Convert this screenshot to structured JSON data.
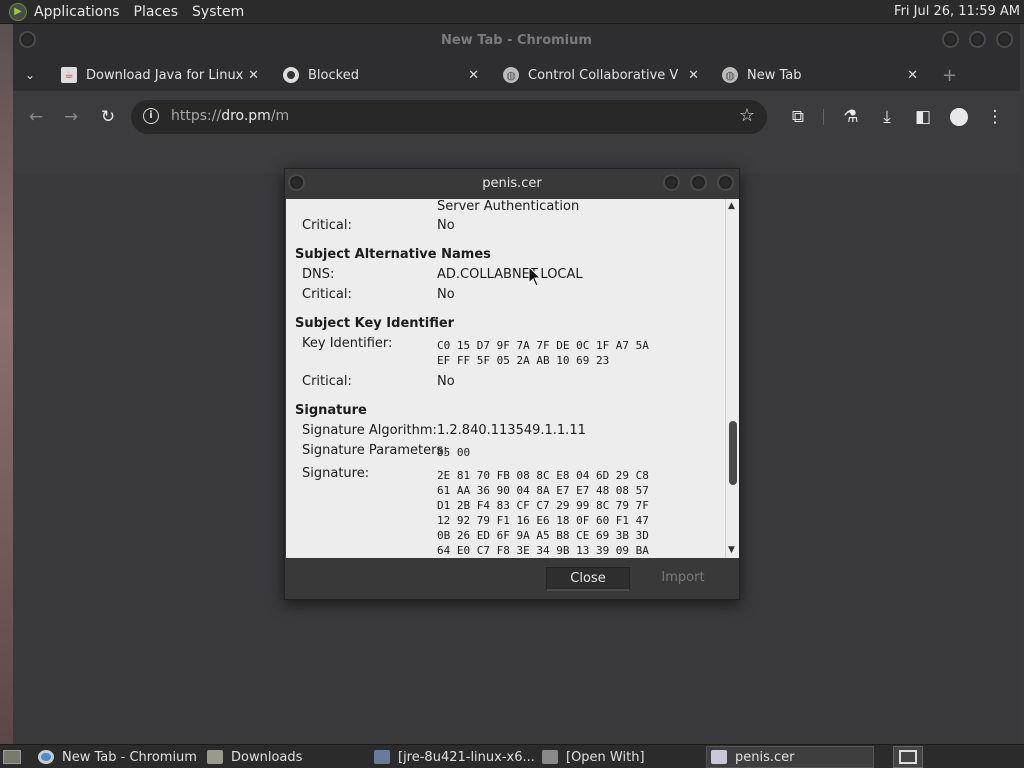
{
  "top_panel": {
    "menus": [
      "Applications",
      "Places",
      "System"
    ],
    "clock": "Fri Jul 26, 11:59 AM"
  },
  "browser": {
    "title": "New Tab - Chromium",
    "tabs": [
      {
        "label": "Download Java for Linux",
        "icon": "java-icon"
      },
      {
        "label": "Blocked",
        "icon": "github-icon"
      },
      {
        "label": "Control Collaborative Virt",
        "icon": "globe-icon"
      },
      {
        "label": "New Tab",
        "icon": "globe-icon"
      }
    ],
    "url_prefix": "https://",
    "url_host": "dro.pm",
    "url_path": "/m"
  },
  "dialog": {
    "title": "penis.cer",
    "top_value": "Server Authentication",
    "critical_label": "Critical:",
    "critical_1": "No",
    "san": {
      "heading": "Subject Alternative Names",
      "dns_label": "DNS:",
      "dns_value": "AD.COLLABNET.LOCAL",
      "critical_value": "No"
    },
    "ski": {
      "heading": "Subject Key Identifier",
      "key_label": "Key Identifier:",
      "key_value": "C0 15 D7 9F 7A 7F DE 0C 1F A7 5A\nEF FF 5F 05 2A AB 10 69 23",
      "critical_value": "No"
    },
    "signature": {
      "heading": "Signature",
      "alg_label": "Signature Algorithm:",
      "alg_value": "1.2.840.113549.1.1.11",
      "params_label": "Signature Parameters:",
      "params_value": "05 00",
      "sig_label": "Signature:",
      "sig_value": "2E 81 70 FB 08 8C E8 04 6D 29 C8\n61 AA 36 90 04 8A E7 E7 48 08 57\nD1 2B F4 83 CF C7 29 99 8C 79 7F\n12 92 79 F1 16 E6 18 0F 60 F1 47\n0B 26 ED 6F 9A A5 B8 CE 69 3B 3D\n64 E0 C7 F8 3E 34 9B 13 39 09 BA"
    },
    "close_label": "Close",
    "import_label": "Import"
  },
  "taskbar": {
    "items": [
      {
        "label": "New Tab - Chromium",
        "icon": "chromium-icon"
      },
      {
        "label": "Downloads",
        "icon": "folder-icon"
      },
      {
        "label": "[jre-8u421-linux-x6...",
        "icon": "archive-icon"
      },
      {
        "label": "[Open With]",
        "icon": "window-icon"
      },
      {
        "label": "penis.cer",
        "icon": "window-icon"
      }
    ]
  },
  "colors": {
    "panel_bg": "#2b2b2b",
    "window_bg": "#3c3c3f",
    "dialog_content_bg": "#ededed"
  }
}
